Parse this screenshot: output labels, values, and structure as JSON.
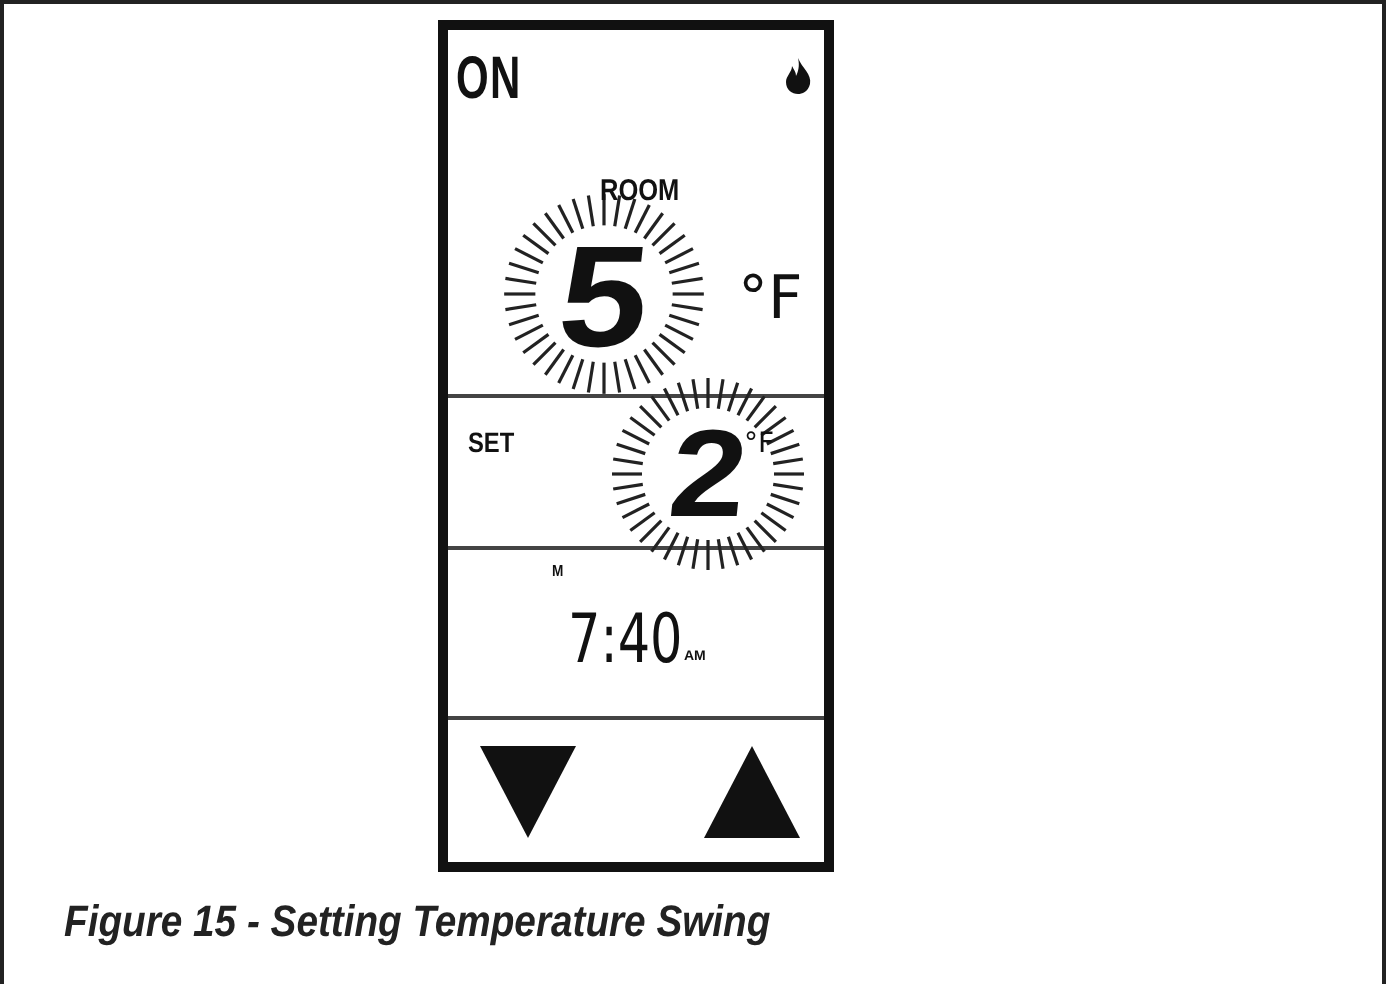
{
  "status": "ON",
  "heating": true,
  "room": {
    "label": "ROOM",
    "value": "5",
    "unit": "°F",
    "flashing": true
  },
  "set": {
    "label": "SET",
    "value": "2",
    "unit": "°F",
    "flashing": true
  },
  "mode_label": "M",
  "time": {
    "value": "7:40",
    "meridiem": "AM"
  },
  "buttons": [
    {
      "kind": "down"
    },
    {
      "kind": "up"
    }
  ],
  "caption": "Figure 15 - Setting Temperature Swing"
}
